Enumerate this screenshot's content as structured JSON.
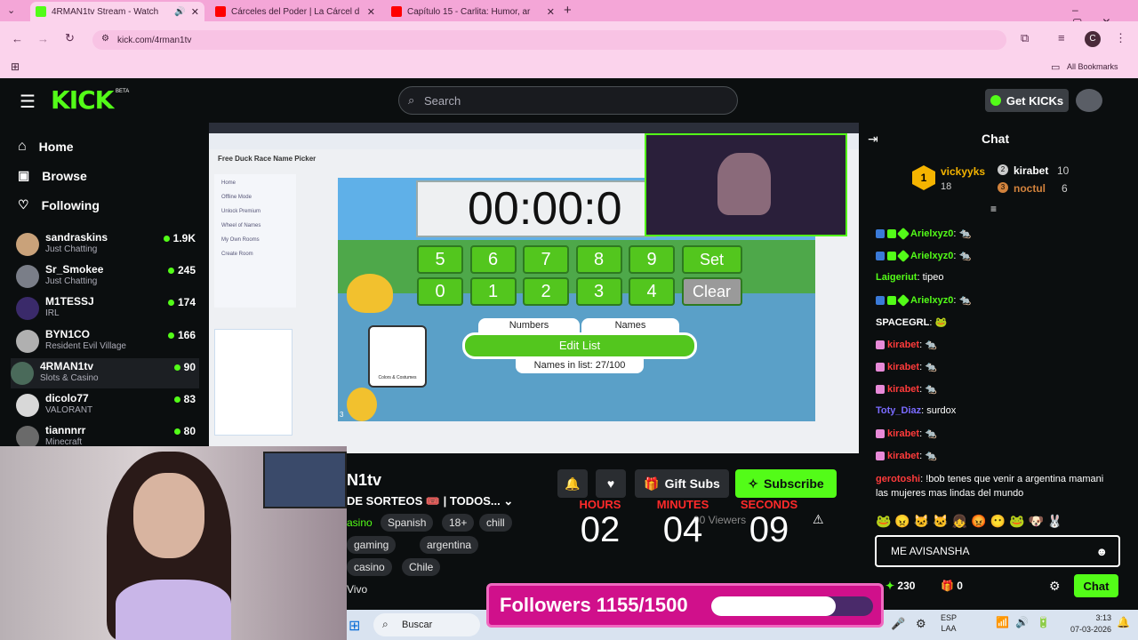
{
  "browser": {
    "tabs": [
      {
        "label": "4RMAN1tv Stream - Watch",
        "fav": "#53fc18"
      },
      {
        "label": "Cárceles del Poder | La Cárcel d",
        "fav": "#ff0000"
      },
      {
        "label": "Capítulo 15 - Carlita: Humor, ar",
        "fav": "#ff0000"
      }
    ],
    "url": "kick.com/4rman1tv",
    "all_bookmarks": "All Bookmarks",
    "profile_initial": "C"
  },
  "kick": {
    "logo": "KICK",
    "beta": "BETA",
    "search_placeholder": "Search",
    "get_kicks": "Get KICKs"
  },
  "sidebar": {
    "nav": [
      {
        "label": "Home",
        "icon": "home-icon"
      },
      {
        "label": "Browse",
        "icon": "browse-icon"
      },
      {
        "label": "Following",
        "icon": "heart-icon"
      }
    ],
    "channels": [
      {
        "name": "sandraskins",
        "category": "Just Chatting",
        "viewers": "1.9K",
        "color": "#c9a27a"
      },
      {
        "name": "Sr_Smokee",
        "category": "Just Chatting",
        "viewers": "245",
        "color": "#7a7e88"
      },
      {
        "name": "M1TESSJ",
        "category": "IRL",
        "viewers": "174",
        "color": "#3a2a6a"
      },
      {
        "name": "BYN1CO",
        "category": "Resident Evil Village",
        "viewers": "166",
        "color": "#b0b0b0"
      },
      {
        "name": "4RMAN1tv",
        "category": "Slots & Casino",
        "viewers": "90",
        "color": "#4a6a5a"
      },
      {
        "name": "dicolo77",
        "category": "VALORANT",
        "viewers": "83",
        "color": "#d8d8d8"
      },
      {
        "name": "tiannnrr",
        "category": "Minecraft",
        "viewers": "80",
        "color": "#6a6a6a"
      }
    ]
  },
  "stream_screen": {
    "site_title": "Free Duck Race Name Picker",
    "timer": "00:00:0",
    "keys": [
      "5",
      "6",
      "7",
      "8",
      "9",
      "Set",
      "0",
      "1",
      "2",
      "3",
      "4",
      "Clear"
    ],
    "numbers_tab": "Numbers",
    "names_tab": "Names",
    "edit_list": "Edit List",
    "names_in_list": "Names in list: 27/100",
    "colors_costumes": "Colors & Costumes",
    "corner_num": "3",
    "menu_items": [
      "Home",
      "Offline Mode",
      "Unlock Premium",
      "Wheel of Names",
      "My Own Rooms",
      "Create Room"
    ]
  },
  "channel": {
    "name": "N1tv",
    "title": "DE SORTEOS 🎟️ | TODOS...",
    "tags": [
      "asino",
      "Spanish",
      "18+",
      "chill",
      "gaming",
      "argentina",
      "casino",
      "Chile",
      "Vivo"
    ],
    "gift_subs": "Gift Subs",
    "subscribe": "Subscribe",
    "viewers": "90 Viewers"
  },
  "countdown": {
    "hours_label": "HOURS",
    "hours": "02",
    "minutes_label": "MINUTES",
    "minutes": "04",
    "seconds_label": "SECONDS",
    "seconds": "09"
  },
  "followers_goal": {
    "text": "Followers 1155/1500",
    "progress": 0.77
  },
  "chat": {
    "title": "Chat",
    "leaderboard": [
      {
        "rank": "1",
        "name": "vickyyks",
        "count": "18"
      },
      {
        "rank": "2",
        "name": "kirabet",
        "count": "10"
      },
      {
        "rank": "3",
        "name": "noctul",
        "count": "6"
      }
    ],
    "messages": [
      {
        "user": "Arielxyz0",
        "text": "🐀",
        "color": "#53fc18"
      },
      {
        "user": "Arielxyz0",
        "text": "🐀",
        "color": "#53fc18"
      },
      {
        "user": "Laigeriut",
        "text": "tipeo",
        "color": "#53fc18"
      },
      {
        "user": "Arielxyz0",
        "text": "🐀",
        "color": "#53fc18"
      },
      {
        "user": "SPACEGRL",
        "text": "🐸",
        "color": "#ffffff"
      },
      {
        "user": "kirabet",
        "text": "🐀",
        "color": "#ff3b3b"
      },
      {
        "user": "kirabet",
        "text": "🐀",
        "color": "#ff3b3b"
      },
      {
        "user": "kirabet",
        "text": "🐀",
        "color": "#ff3b3b"
      },
      {
        "user": "Toty_Diaz",
        "text": "surdox",
        "color": "#7a6bff"
      },
      {
        "user": "kirabet",
        "text": "🐀",
        "color": "#ff3b3b"
      },
      {
        "user": "kirabet",
        "text": "🐀",
        "color": "#ff3b3b"
      }
    ],
    "long_msg_user": "gerotoshi",
    "long_msg_text": "!bob tenes que venir a argentina mamani las mujeres mas lindas del mundo",
    "input_value": "ME AVISANSHA",
    "points": "230",
    "gifts": "0",
    "send": "Chat"
  },
  "taskbar": {
    "search": "Buscar",
    "lang": "ESP",
    "lang2": "LAA",
    "time": "3:13",
    "date": "07-03-2026"
  }
}
